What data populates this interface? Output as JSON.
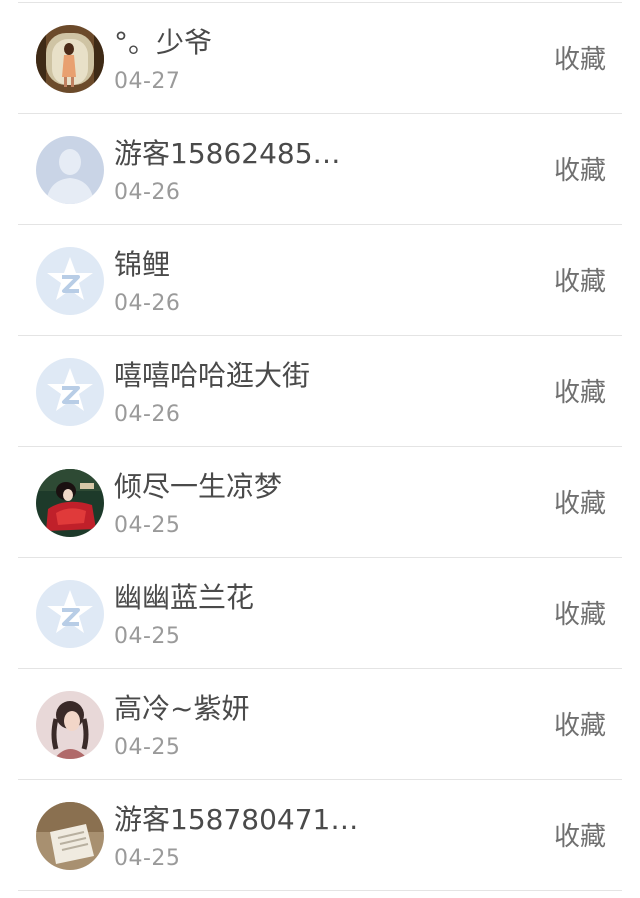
{
  "users": [
    {
      "name": "°。少爷",
      "date": "04-27",
      "action": "收藏",
      "avatar": "photo-girl-window-avatar"
    },
    {
      "name": "游客15862485…",
      "date": "04-26",
      "action": "收藏",
      "avatar": "default-person-avatar"
    },
    {
      "name": "锦鲤",
      "date": "04-26",
      "action": "收藏",
      "avatar": "qzone-star-avatar"
    },
    {
      "name": "嘻嘻哈哈逛大街",
      "date": "04-26",
      "action": "收藏",
      "avatar": "qzone-star-avatar"
    },
    {
      "name": "倾尽一生凉梦",
      "date": "04-25",
      "action": "收藏",
      "avatar": "photo-red-dress-avatar"
    },
    {
      "name": "幽幽蓝兰花",
      "date": "04-25",
      "action": "收藏",
      "avatar": "qzone-star-avatar"
    },
    {
      "name": "高冷~紫妍",
      "date": "04-25",
      "action": "收藏",
      "avatar": "photo-braids-girl-avatar"
    },
    {
      "name": "游客158780471…",
      "date": "04-25",
      "action": "收藏",
      "avatar": "photo-paper-avatar"
    }
  ],
  "colors": {
    "name_text": "#4a4a4a",
    "date_text": "#9a9a9a",
    "action_text": "#707070",
    "divider": "#e4e4e4",
    "qzone_avatar_bg": "#dfe9f5"
  }
}
